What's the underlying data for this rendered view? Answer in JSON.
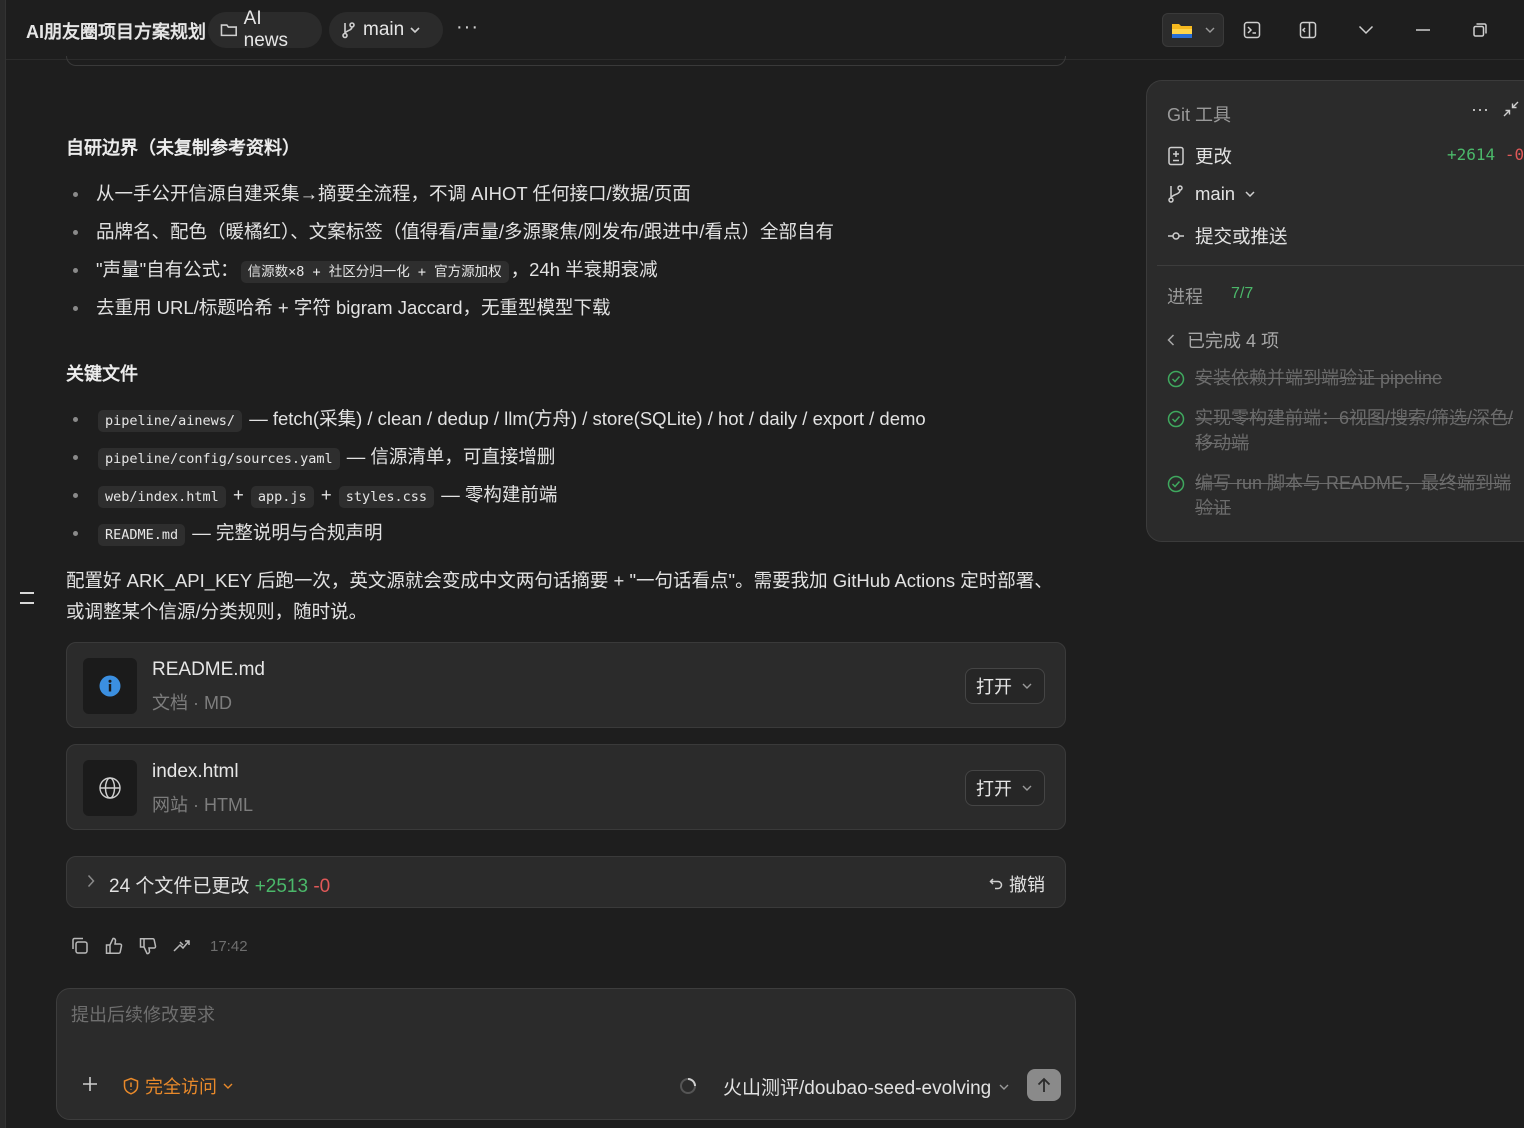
{
  "titlebar": {
    "app_title": "AI朋友圈项目方案规划",
    "folder_label": "AI news",
    "branch_label": "main",
    "more": "···"
  },
  "content": {
    "heading_boundary": "自研边界（未复制参考资料）",
    "boundary_items": [
      "从一手公开信源自建采集→摘要全流程，不调 AIHOT 任何接口/数据/页面",
      "品牌名、配色（暖橘红）、文案标签（值得看/声量/多源聚焦/刚发布/跟进中/看点）全部自有",
      {
        "prefix": "\"声量\"自有公式：",
        "code": "信源数×8 + 社区分归一化 + 官方源加权",
        "suffix": "，24h 半衰期衰减"
      },
      "去重用 URL/标题哈希 + 字符 bigram Jaccard，无重型模型下载"
    ],
    "heading_files": "关键文件",
    "file_items": [
      {
        "code1": "pipeline/ainews/",
        "text": "— fetch(采集) / clean / dedup / llm(方舟) / store(SQLite) / hot / daily / export / demo"
      },
      {
        "code1": "pipeline/config/sources.yaml",
        "text": "— 信源清单，可直接增删"
      },
      {
        "code1": "web/index.html",
        "plus1": "+",
        "code2": "app.js",
        "plus2": "+",
        "code3": "styles.css",
        "text": "— 零构建前端"
      },
      {
        "code1": "README.md",
        "text": "— 完整说明与合规声明"
      }
    ],
    "paragraph": "配置好 ARK_API_KEY 后跑一次，英文源就会变成中文两句话摘要 + \"一句话看点\"。需要我加 GitHub Actions 定时部署、或调整某个信源/分类规则，随时说。"
  },
  "file_cards": [
    {
      "name": "README.md",
      "meta": "文档 · MD",
      "icon": "info-icon",
      "open_label": "打开"
    },
    {
      "name": "index.html",
      "meta": "网站 · HTML",
      "icon": "globe-icon",
      "open_label": "打开"
    }
  ],
  "changes": {
    "text": "24 个文件已更改",
    "additions": "+2513",
    "deletions": "-0",
    "undo_label": "撤销"
  },
  "message_actions": {
    "time": "17:42"
  },
  "composer": {
    "placeholder": "提出后续修改要求",
    "access_label": "完全访问",
    "model_label": "火山测评/doubao-seed-evolving"
  },
  "git_panel": {
    "title": "Git 工具",
    "changes_label": "更改",
    "additions": "+2614",
    "deletions": "-0",
    "branch": "main",
    "commit_label": "提交或推送",
    "progress_label": "进程",
    "progress_value": "7/7",
    "completed_label": "已完成 4 项",
    "tasks": [
      "安装依赖并端到端验证 pipeline",
      "实现零构建前端：6视图/搜索/筛选/深色/移动端",
      "编写 run 脚本与 README，最终端到端验证"
    ]
  },
  "colors": {
    "background": "#1e1e1e",
    "card": "#2b2b2b",
    "accent_orange": "#e8892a",
    "success_green": "#4bb86a",
    "danger_red": "#e05858",
    "info_blue": "#3b8fe0"
  }
}
